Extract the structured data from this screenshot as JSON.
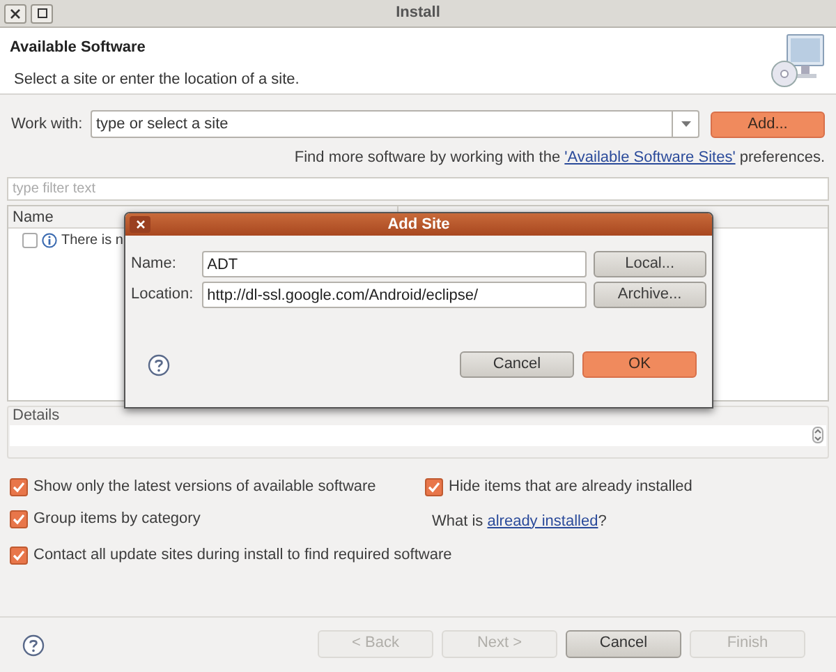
{
  "window": {
    "title": "Install"
  },
  "header": {
    "title": "Available Software",
    "subtitle": "Select a site or enter the location of a site."
  },
  "work_with": {
    "label": "Work with:",
    "placeholder": "type or select a site",
    "add_button": "Add..."
  },
  "find_more": {
    "before": "Find more software by working with the ",
    "link": "'Available Software Sites'",
    "after": " preferences."
  },
  "filter": {
    "placeholder": "type filter text"
  },
  "table": {
    "columns": [
      "Name"
    ],
    "rows": [
      {
        "checked": false,
        "text": "There is n"
      }
    ]
  },
  "details": {
    "label": "Details"
  },
  "options": [
    {
      "label": "Show only the latest versions of available software",
      "checked": true
    },
    {
      "label": "Hide items that are already installed",
      "checked": true
    },
    {
      "label": "Group items by category",
      "checked": true
    },
    {
      "label": "Contact all update sites during install to find required software",
      "checked": true
    }
  ],
  "installed_note": {
    "before": "What is ",
    "link": "already installed",
    "after": "?"
  },
  "buttons": [
    {
      "label": "< Back",
      "disabled": true
    },
    {
      "label": "Next >",
      "disabled": true
    },
    {
      "label": "Cancel",
      "disabled": false
    },
    {
      "label": "Finish",
      "disabled": true
    }
  ],
  "dialog": {
    "title": "Add Site",
    "fields": [
      {
        "label": "Name:",
        "value": "ADT",
        "button": "Local..."
      },
      {
        "label": "Location:",
        "value": "http://dl-ssl.google.com/Android/eclipse/",
        "button": "Archive..."
      }
    ],
    "buttons": [
      {
        "label": "Cancel",
        "kind": "plain"
      },
      {
        "label": "OK",
        "kind": "primary"
      }
    ]
  }
}
